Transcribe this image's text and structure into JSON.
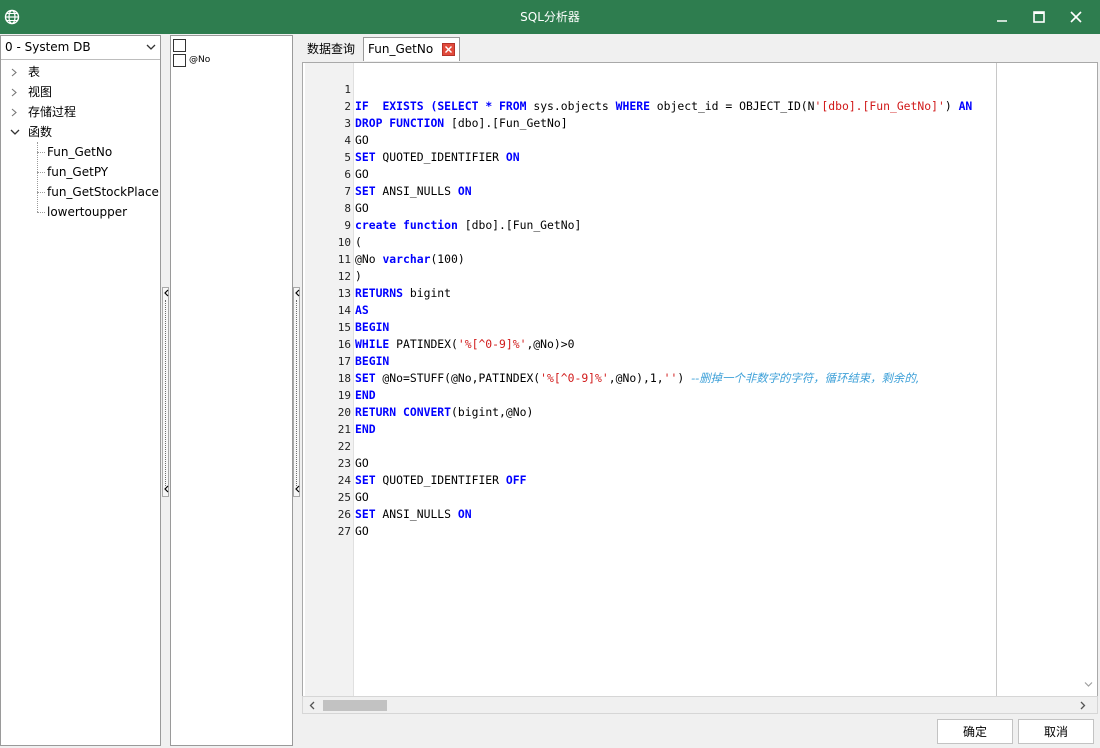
{
  "window": {
    "title": "SQL分析器",
    "accent": "#2e7d4f"
  },
  "db_select": {
    "value": "0 - System DB"
  },
  "tree": {
    "categories": [
      {
        "label": "表",
        "expanded": false
      },
      {
        "label": "视图",
        "expanded": false
      },
      {
        "label": "存储过程",
        "expanded": false
      },
      {
        "label": "函数",
        "expanded": true
      }
    ],
    "functions": [
      "Fun_GetNo",
      "fun_GetPY",
      "fun_GetStockPlace",
      "lowertoupper"
    ]
  },
  "params": {
    "items": [
      "",
      "@No"
    ]
  },
  "tabs": [
    {
      "label": "数据查询"
    },
    {
      "label": "Fun_GetNo"
    }
  ],
  "code": {
    "line_numbers": [
      "1",
      "2",
      "3",
      "4",
      "5",
      "6",
      "7",
      "8",
      "9",
      "10",
      "11",
      "12",
      "13",
      "14",
      "15",
      "16",
      "17",
      "18",
      "19",
      "20",
      "21",
      "22",
      "23",
      "24",
      "25",
      "26",
      "27"
    ],
    "l1": [
      "IF",
      "EXISTS",
      "(",
      "SELECT",
      " * ",
      "FROM",
      " sys.objects ",
      "WHERE",
      " object_id = OBJECT_ID(N",
      "'[dbo].[Fun_GetNo]'",
      ") ",
      "AN"
    ],
    "l2": [
      "DROP",
      "FUNCTION",
      " [dbo].[Fun_GetNo]"
    ],
    "l3": "GO",
    "l4": [
      "SET",
      " QUOTED_IDENTIFIER ",
      "ON"
    ],
    "l5": "GO",
    "l6": [
      "SET",
      " ANSI_NULLS ",
      "ON"
    ],
    "l7": "GO",
    "l8": [
      "create",
      "function",
      " [dbo].[Fun_GetNo]"
    ],
    "l9": "(",
    "l10": [
      "@No ",
      "varchar",
      "(100)"
    ],
    "l11": ")",
    "l12": [
      "RETURNS",
      " bigint"
    ],
    "l13": "AS",
    "l14": "BEGIN",
    "l15": [
      "WHILE",
      " PATINDEX(",
      "'%[^0-9]%'",
      ",@No)>0"
    ],
    "l16": "BEGIN",
    "l17": [
      "SET",
      " @No=STUFF(@No,PATINDEX(",
      "'%[^0-9]%'",
      ",@No),1,",
      "''",
      ") ",
      "--删掉一个非数字的字符，循环结束，剩余的,"
    ],
    "l18": "END",
    "l19": [
      "RETURN",
      "CONVERT",
      "(bigint,@No)"
    ],
    "l20": "END",
    "l21": "",
    "l22": "GO",
    "l23": [
      "SET",
      " QUOTED_IDENTIFIER ",
      "OFF"
    ],
    "l24": "GO",
    "l25": [
      "SET",
      " ANSI_NULLS ",
      "ON"
    ],
    "l26": "GO",
    "l27": ""
  },
  "buttons": {
    "ok": "确定",
    "cancel": "取消"
  }
}
